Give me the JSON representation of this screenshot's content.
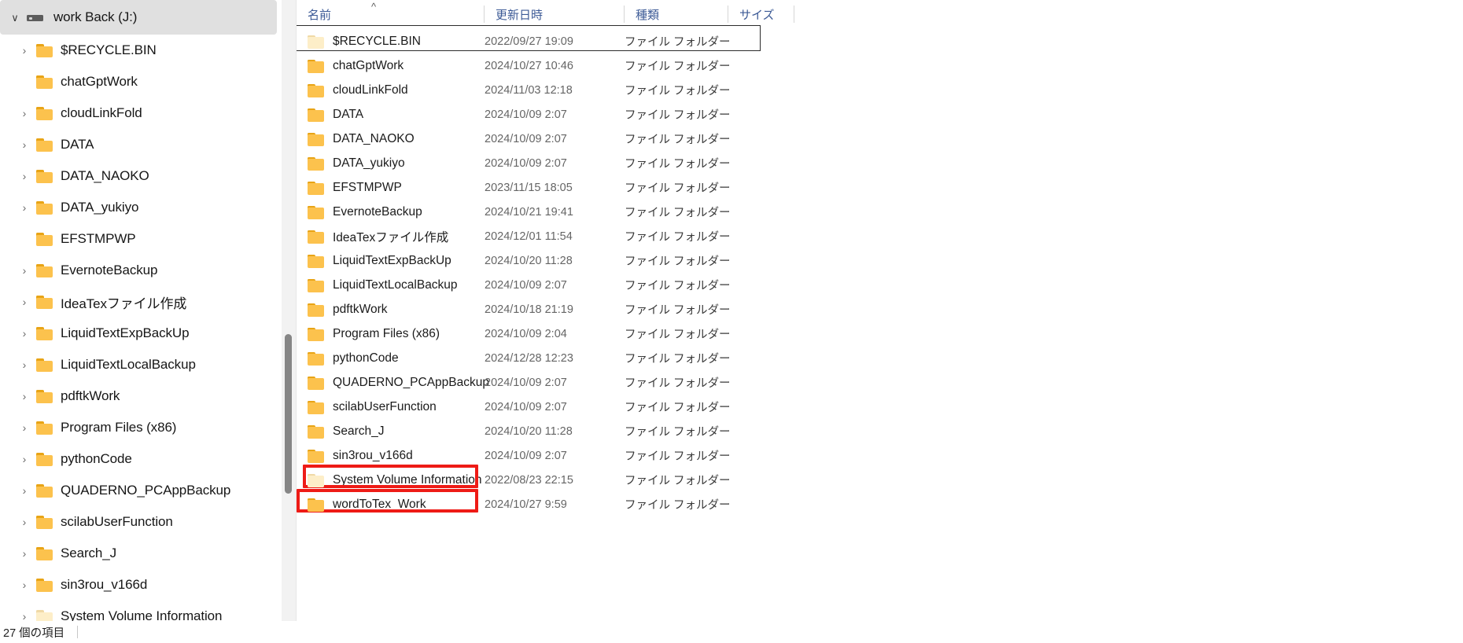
{
  "window": {
    "title": "work Back (J:)"
  },
  "nav_pane": {
    "root": {
      "label": "work Back (J:)",
      "chevron": "expanded",
      "icon": "drive-icon"
    },
    "items": [
      {
        "label": "$RECYCLE.BIN",
        "chevron": "collapsed",
        "icon": "folder-icon",
        "pale": false
      },
      {
        "label": "chatGptWork",
        "chevron": "none",
        "icon": "folder-icon",
        "pale": false
      },
      {
        "label": "cloudLinkFold",
        "chevron": "collapsed",
        "icon": "folder-icon",
        "pale": false
      },
      {
        "label": "DATA",
        "chevron": "collapsed",
        "icon": "folder-icon",
        "pale": false
      },
      {
        "label": "DATA_NAOKO",
        "chevron": "collapsed",
        "icon": "folder-icon",
        "pale": false
      },
      {
        "label": "DATA_yukiyo",
        "chevron": "collapsed",
        "icon": "folder-icon",
        "pale": false
      },
      {
        "label": "EFSTMPWP",
        "chevron": "none",
        "icon": "folder-icon",
        "pale": false
      },
      {
        "label": "EvernoteBackup",
        "chevron": "collapsed",
        "icon": "folder-icon",
        "pale": false
      },
      {
        "label": "IdeaTexファイル作成",
        "chevron": "collapsed",
        "icon": "folder-icon",
        "pale": false
      },
      {
        "label": "LiquidTextExpBackUp",
        "chevron": "collapsed",
        "icon": "folder-icon",
        "pale": false
      },
      {
        "label": "LiquidTextLocalBackup",
        "chevron": "collapsed",
        "icon": "folder-icon",
        "pale": false
      },
      {
        "label": "pdftkWork",
        "chevron": "collapsed",
        "icon": "folder-icon",
        "pale": false
      },
      {
        "label": "Program Files (x86)",
        "chevron": "collapsed",
        "icon": "folder-icon",
        "pale": false
      },
      {
        "label": "pythonCode",
        "chevron": "collapsed",
        "icon": "folder-icon",
        "pale": false
      },
      {
        "label": "QUADERNO_PCAppBackup",
        "chevron": "collapsed",
        "icon": "folder-icon",
        "pale": false
      },
      {
        "label": "scilabUserFunction",
        "chevron": "collapsed",
        "icon": "folder-icon",
        "pale": false
      },
      {
        "label": "Search_J",
        "chevron": "collapsed",
        "icon": "folder-icon",
        "pale": false
      },
      {
        "label": "sin3rou_v166d",
        "chevron": "collapsed",
        "icon": "folder-icon",
        "pale": false
      },
      {
        "label": "System Volume Information",
        "chevron": "collapsed",
        "icon": "folder-icon",
        "pale": true
      }
    ]
  },
  "list_pane": {
    "columns": [
      {
        "key": "name",
        "label": "名前",
        "sort": "ascending"
      },
      {
        "key": "date",
        "label": "更新日時",
        "sort": "none"
      },
      {
        "key": "type",
        "label": "種類",
        "sort": "none"
      },
      {
        "key": "size",
        "label": "サイズ",
        "sort": "none"
      }
    ],
    "sort_caret": "^",
    "rows": [
      {
        "name": "$RECYCLE.BIN",
        "date": "2022/09/27 19:09",
        "type": "ファイル フォルダー",
        "size": "",
        "selected": true,
        "highlight": "none",
        "pale": true
      },
      {
        "name": "chatGptWork",
        "date": "2024/10/27 10:46",
        "type": "ファイル フォルダー",
        "size": "",
        "selected": false,
        "highlight": "none",
        "pale": false
      },
      {
        "name": "cloudLinkFold",
        "date": "2024/11/03 12:18",
        "type": "ファイル フォルダー",
        "size": "",
        "selected": false,
        "highlight": "none",
        "pale": false
      },
      {
        "name": "DATA",
        "date": "2024/10/09 2:07",
        "type": "ファイル フォルダー",
        "size": "",
        "selected": false,
        "highlight": "none",
        "pale": false
      },
      {
        "name": "DATA_NAOKO",
        "date": "2024/10/09 2:07",
        "type": "ファイル フォルダー",
        "size": "",
        "selected": false,
        "highlight": "none",
        "pale": false
      },
      {
        "name": "DATA_yukiyo",
        "date": "2024/10/09 2:07",
        "type": "ファイル フォルダー",
        "size": "",
        "selected": false,
        "highlight": "none",
        "pale": false
      },
      {
        "name": "EFSTMPWP",
        "date": "2023/11/15 18:05",
        "type": "ファイル フォルダー",
        "size": "",
        "selected": false,
        "highlight": "none",
        "pale": false
      },
      {
        "name": "EvernoteBackup",
        "date": "2024/10/21 19:41",
        "type": "ファイル フォルダー",
        "size": "",
        "selected": false,
        "highlight": "none",
        "pale": false
      },
      {
        "name": "IdeaTexファイル作成",
        "date": "2024/12/01 11:54",
        "type": "ファイル フォルダー",
        "size": "",
        "selected": false,
        "highlight": "none",
        "pale": false
      },
      {
        "name": "LiquidTextExpBackUp",
        "date": "2024/10/20 11:28",
        "type": "ファイル フォルダー",
        "size": "",
        "selected": false,
        "highlight": "none",
        "pale": false
      },
      {
        "name": "LiquidTextLocalBackup",
        "date": "2024/10/09 2:07",
        "type": "ファイル フォルダー",
        "size": "",
        "selected": false,
        "highlight": "none",
        "pale": false
      },
      {
        "name": "pdftkWork",
        "date": "2024/10/18 21:19",
        "type": "ファイル フォルダー",
        "size": "",
        "selected": false,
        "highlight": "none",
        "pale": false
      },
      {
        "name": "Program Files (x86)",
        "date": "2024/10/09 2:04",
        "type": "ファイル フォルダー",
        "size": "",
        "selected": false,
        "highlight": "none",
        "pale": false
      },
      {
        "name": "pythonCode",
        "date": "2024/12/28 12:23",
        "type": "ファイル フォルダー",
        "size": "",
        "selected": false,
        "highlight": "none",
        "pale": false
      },
      {
        "name": "QUADERNO_PCAppBackup",
        "date": "2024/10/09 2:07",
        "type": "ファイル フォルダー",
        "size": "",
        "selected": false,
        "highlight": "none",
        "pale": false
      },
      {
        "name": "scilabUserFunction",
        "date": "2024/10/09 2:07",
        "type": "ファイル フォルダー",
        "size": "",
        "selected": false,
        "highlight": "none",
        "pale": false
      },
      {
        "name": "Search_J",
        "date": "2024/10/20 11:28",
        "type": "ファイル フォルダー",
        "size": "",
        "selected": false,
        "highlight": "none",
        "pale": false
      },
      {
        "name": "sin3rou_v166d",
        "date": "2024/10/09 2:07",
        "type": "ファイル フォルダー",
        "size": "",
        "selected": false,
        "highlight": "none",
        "pale": false
      },
      {
        "name": "System Volume Information",
        "date": "2022/08/23 22:15",
        "type": "ファイル フォルダー",
        "size": "",
        "selected": false,
        "highlight": "red-a",
        "pale": true
      },
      {
        "name": "wordToTex_Work",
        "date": "2024/10/27 9:59",
        "type": "ファイル フォルダー",
        "size": "",
        "selected": false,
        "highlight": "red-b",
        "pale": false
      }
    ]
  },
  "status_bar": {
    "item_count_text": "27 個の項目"
  },
  "colors": {
    "highlight_red": "#ee1b16",
    "header_text_blue": "#3c5a96",
    "folder_yellow": "#fcc24d",
    "selection_gray": "#e0e0e0",
    "scrollbar_thumb": "#868686"
  }
}
